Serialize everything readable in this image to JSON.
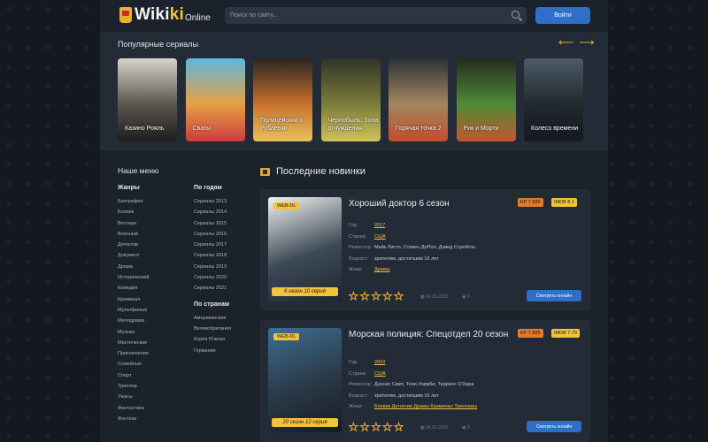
{
  "header": {
    "logo_main": "Wiki",
    "logo_ki": "ki",
    "logo_sub": "Online",
    "search_placeholder": "Поиск по сайту...",
    "login_label": "Войти"
  },
  "popular": {
    "title": "Популярные сериалы",
    "cards": [
      {
        "title": "Казино Рояль",
        "colors": [
          "#d8d4cd",
          "#5b5650",
          "#1e1e1e"
        ]
      },
      {
        "title": "Сваты",
        "colors": [
          "#5fb7e0",
          "#e4a044",
          "#cc3d3d"
        ]
      },
      {
        "title": "Полицейский с Рублевки",
        "colors": [
          "#2a2520",
          "#c7702d",
          "#e8c15a"
        ]
      },
      {
        "title": "Чернобыль. Зона отчуждения",
        "colors": [
          "#30342a",
          "#7b7b3a",
          "#cfc35a"
        ]
      },
      {
        "title": "Горячая точка 2",
        "colors": [
          "#2d3136",
          "#a38660",
          "#c64b2b"
        ]
      },
      {
        "title": "Рик и Морти",
        "colors": [
          "#232b1e",
          "#4e8a36",
          "#c3572c"
        ]
      },
      {
        "title": "Колесо времени",
        "colors": [
          "#4d5b66",
          "#22292f",
          "#141a1f"
        ]
      }
    ]
  },
  "sidebar": {
    "title": "Наше меню",
    "genres_title": "Жанры",
    "genres": [
      "Биография",
      "Боевик",
      "Вестерн",
      "Военный",
      "Детектив",
      "Документ",
      "Драма",
      "Исторический",
      "Комедия",
      "Криминал",
      "Мультфильм",
      "Мелодрама",
      "Музыка",
      "Мистические",
      "Приключения",
      "Семейные",
      "Спорт",
      "Триллер",
      "Ужасы",
      "Фантастика",
      "Фэнтези"
    ],
    "years_title": "По годам",
    "years": [
      "Сериалы 2013",
      "Сериалы 2014",
      "Сериалы 2015",
      "Сериалы 2016",
      "Сериалы 2017",
      "Сериалы 2018",
      "Сериалы 2019",
      "Сериалы 2020",
      "Сериалы 2021"
    ],
    "countries_title": "По странам",
    "countries": [
      "Американские",
      "Великобритания",
      "Корея Южная",
      "Германия"
    ]
  },
  "main": {
    "title": "Последние новинки",
    "labels": {
      "year": "Год:",
      "country": "Страна:",
      "director": "Режиссер:",
      "age": "Возраст:",
      "genre": "Жанр:",
      "watch": "Смотреть онлайн"
    },
    "movies": [
      {
        "title": "Хороший доктор 6 сезон",
        "kp": "KP 7.896",
        "imdb": "IMDB 8.1",
        "year": "2017",
        "country": "США",
        "director": "Майк Листо, Стивен ДеПол, Дэвид Стрейтон",
        "age": "зрителям, достигшим 16 лет",
        "genre": "Драмы",
        "badge": "WEB-DL",
        "episodes": "6 сезон 10 серия",
        "date": "24.01.2023",
        "views": "0",
        "poster_colors": [
          "#f2f2f0",
          "#3c4a57",
          "#1f2730"
        ]
      },
      {
        "title": "Морская полиция: Спецотдел 20 сезон",
        "kp": "KP 7.895",
        "imdb": "IMDB 7.70",
        "year": "2003",
        "country": "США",
        "director": "Дэннис Смит, Тони Уормби, Терренс О'Хара",
        "age": "зрителям, достигшим 16 лет",
        "genre": "Боевик Детектив Драмы Криминал Триллеры",
        "badge": "WEB-DL",
        "episodes": "20 сезон 12 серия",
        "date": "24.01.2023",
        "views": "0",
        "poster_colors": [
          "#3e6d92",
          "#2a3947",
          "#141c24"
        ]
      }
    ]
  }
}
